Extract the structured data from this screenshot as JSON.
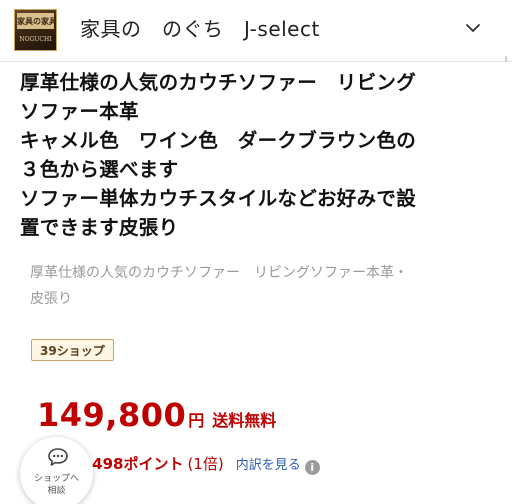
{
  "header": {
    "logo_top_text": "家具の家具",
    "logo_bottom_text": "NOGUCHI",
    "shop_name": "家具の　のぐち　J-select",
    "chevron_icon": "chevron-down-icon"
  },
  "product": {
    "title_lines": [
      "厚革仕様の人気のカウチソファー　リビング",
      "ソファー本革",
      "キャメル色　ワイン色　ダークブラウン色の",
      "３色から選べます",
      "ソファー単体カウチスタイルなどお好みで設",
      "置できます皮張り"
    ],
    "subtitle_lines": [
      "厚革仕様の人気のカウチソファー　リビングソファー本革・",
      "皮張り"
    ],
    "badge": "39ショップ",
    "price": "149,800",
    "price_unit": "円",
    "shipping": "送料無料",
    "points": "1,498ポイント",
    "points_rate": "(1倍)",
    "points_breakdown": "内訳を見る",
    "info_icon_glyph": "i"
  },
  "consult": {
    "icon": "chat-bubble-icon",
    "label_line1": "ショップへ",
    "label_line2": "相談"
  },
  "colors": {
    "price_red": "#bf0000",
    "link_blue": "#2b5fb3",
    "badge_border": "#c9a36a",
    "badge_bg": "#fff6e5"
  }
}
